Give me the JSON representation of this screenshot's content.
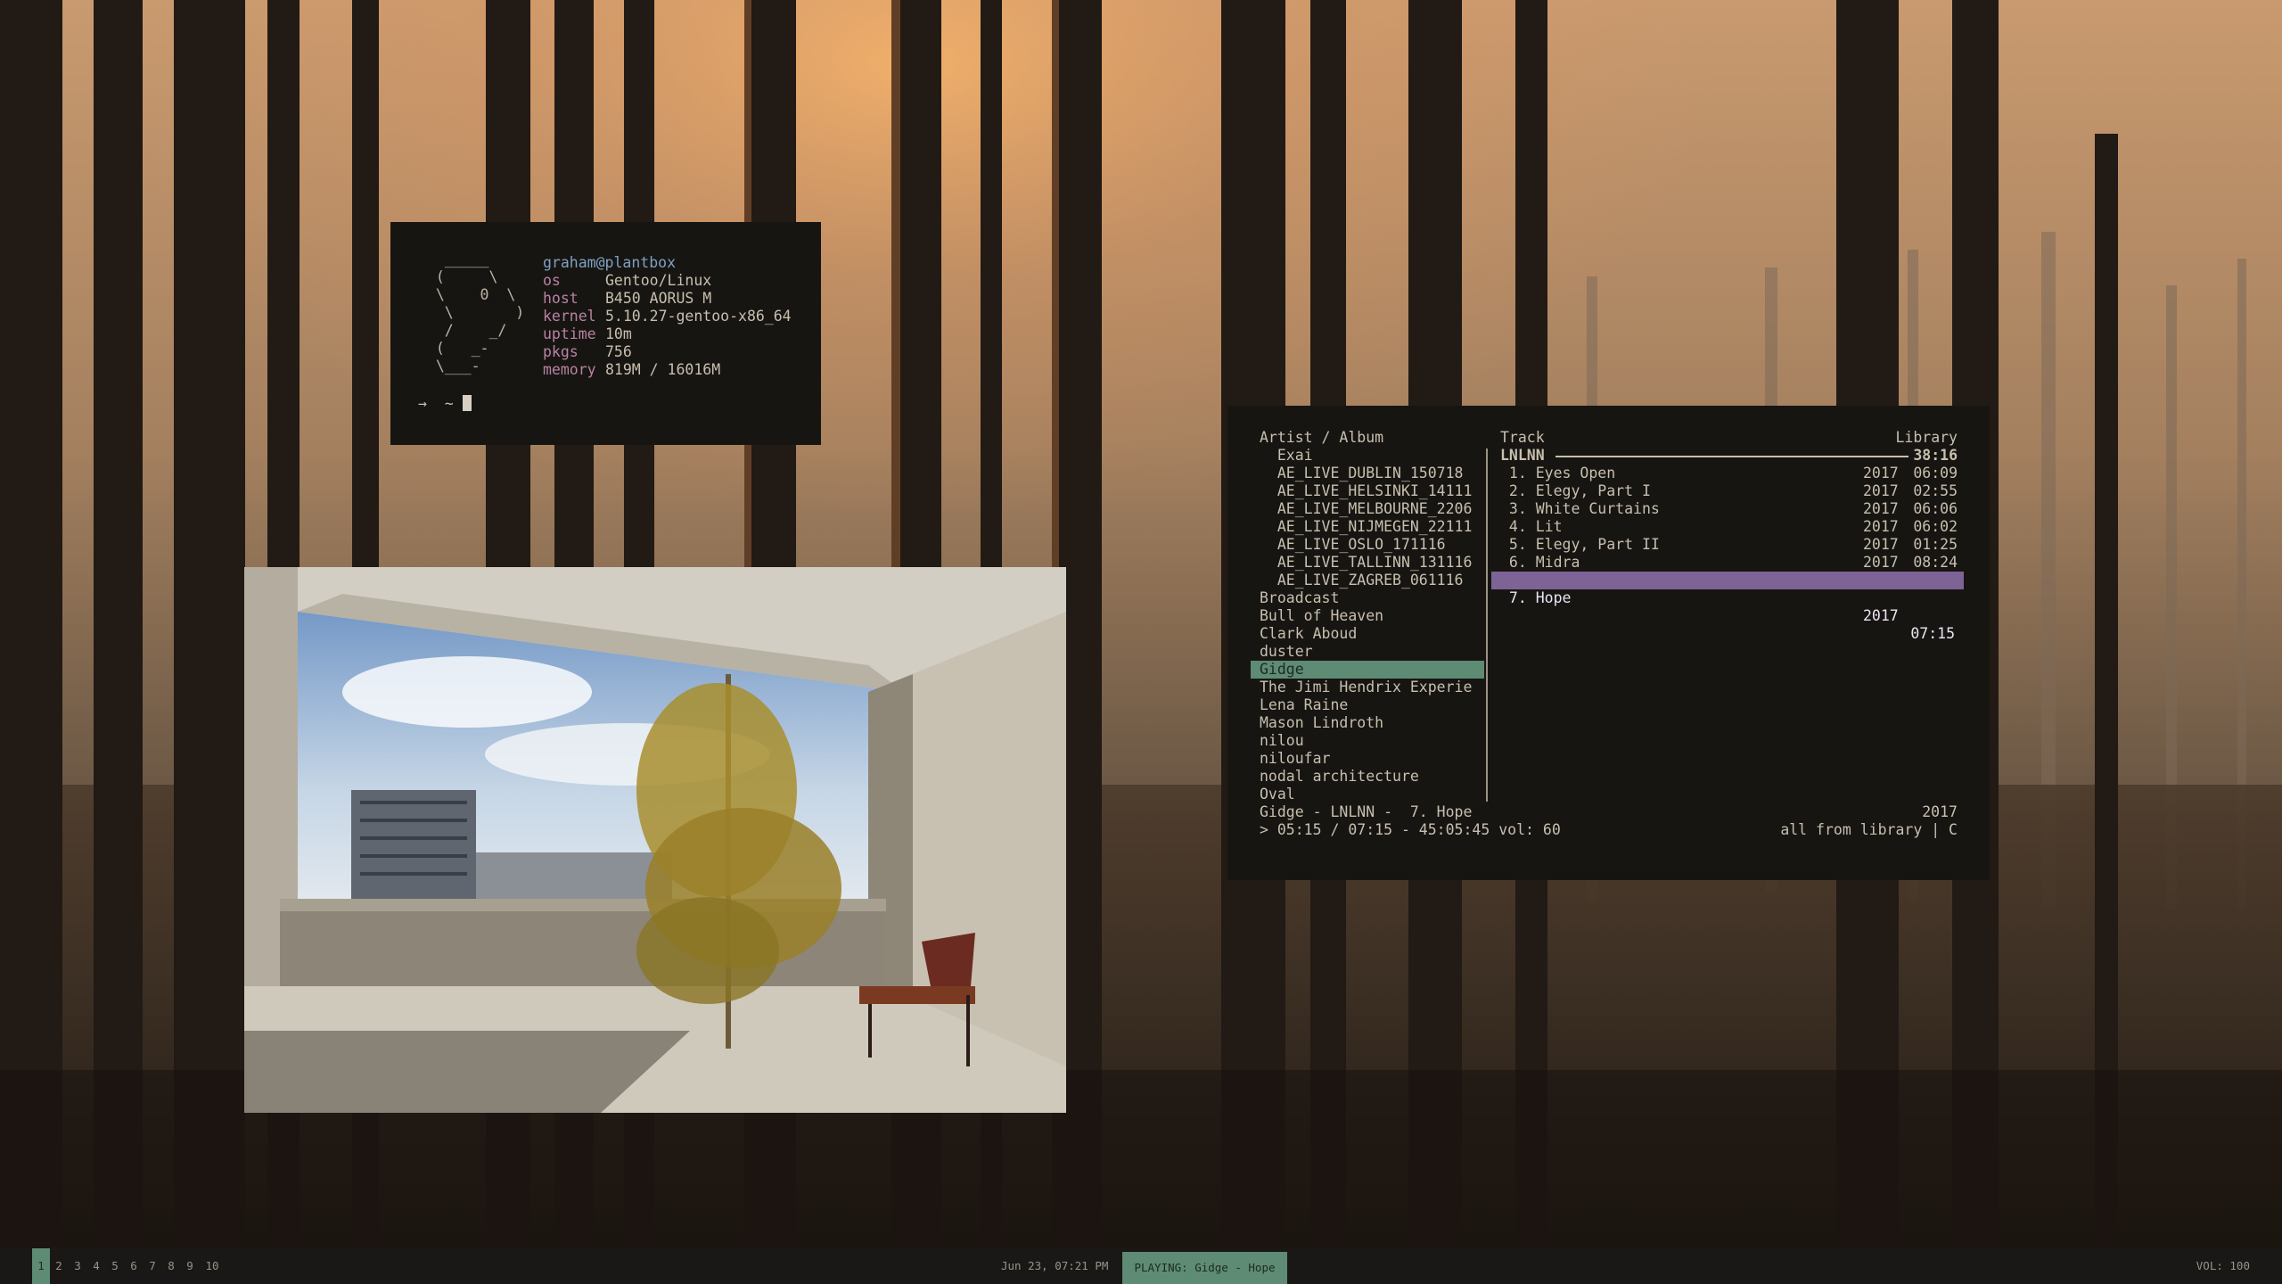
{
  "colors": {
    "accent_green": "#5e8b74",
    "accent_purple": "#7d6396",
    "terminal_bg": "#171512",
    "bar_bg": "#1a1816"
  },
  "fetch": {
    "ascii": "   _____\n  (     \\\n  \\    0  \\\n   \\       )\n   /    _/\n  (   _-\n  \\___-",
    "user_host": "graham@plantbox",
    "rows": [
      {
        "key": "os",
        "value": "Gentoo/Linux"
      },
      {
        "key": "host",
        "value": "B450 AORUS M"
      },
      {
        "key": "kernel",
        "value": "5.10.27-gentoo-x86_64"
      },
      {
        "key": "uptime",
        "value": "10m"
      },
      {
        "key": "pkgs",
        "value": "756"
      },
      {
        "key": "memory",
        "value": "819M / 16016M"
      }
    ],
    "prompt": "→  ~ "
  },
  "player": {
    "left_header": "Artist / Album",
    "right_header_track": "Track",
    "right_header_library": "Library",
    "album_title": "LNLNN",
    "album_length": "38:16",
    "artists": [
      "  Exai",
      "  AE_LIVE_DUBLIN_150718",
      "  AE_LIVE_HELSINKI_14111",
      "  AE_LIVE_MELBOURNE_2206",
      "  AE_LIVE_NIJMEGEN_22111",
      "  AE_LIVE_OSLO_171116",
      "  AE_LIVE_TALLINN_131116",
      "  AE_LIVE_ZAGREB_061116",
      "Broadcast",
      "Bull of Heaven",
      "Clark Aboud",
      "duster",
      "Gidge",
      "The Jimi Hendrix Experie",
      "Lena Raine",
      "Mason Lindroth",
      "nilou",
      "niloufar",
      "nodal architecture",
      "Oval"
    ],
    "selected_artist_index": 12,
    "tracks": [
      {
        "title": " 1. Eyes Open",
        "year": "2017",
        "length": "06:09"
      },
      {
        "title": " 2. Elegy, Part I",
        "year": "2017",
        "length": "02:55"
      },
      {
        "title": " 3. White Curtains",
        "year": "2017",
        "length": "06:06"
      },
      {
        "title": " 4. Lit",
        "year": "2017",
        "length": "06:02"
      },
      {
        "title": " 5. Elegy, Part II",
        "year": "2017",
        "length": "01:25"
      },
      {
        "title": " 6. Midra",
        "year": "2017",
        "length": "08:24"
      },
      {
        "title": " 7. Hope",
        "year": "2017",
        "length": "07:15"
      }
    ],
    "selected_track_index": 6,
    "status_now_playing": "Gidge - LNLNN -  7. Hope",
    "status_year": "2017",
    "status_progress": "> 05:15 / 07:15 - 45:05:45 vol: 60",
    "status_mode": "all from library | C"
  },
  "bar": {
    "workspaces": [
      "1",
      "2",
      "3",
      "4",
      "5",
      "6",
      "7",
      "8",
      "9",
      "10"
    ],
    "active_workspace": "1",
    "datetime": "Jun 23, 07:21 PM",
    "now_playing": "PLAYING: Gidge - Hope",
    "volume": "VOL: 100"
  }
}
